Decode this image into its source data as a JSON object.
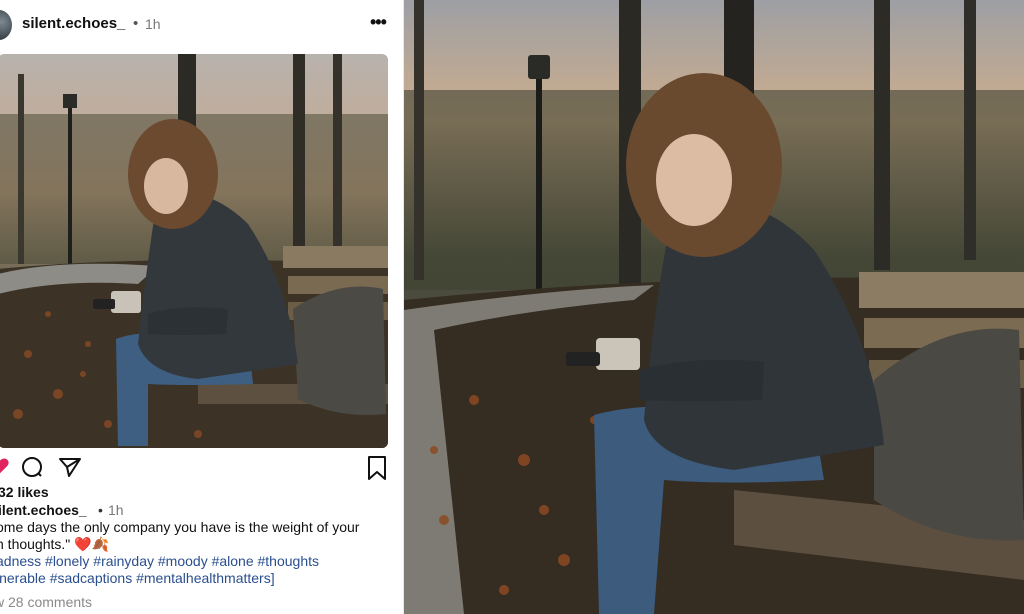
{
  "post": {
    "username": "silent.echoes_",
    "separator": "•",
    "time": "1h",
    "more_label": "•••",
    "likes": "32 likes",
    "caption_username": "ilent.echoes_",
    "caption_separator": "•",
    "caption_time": "1h",
    "caption_line1": "ome days the only company you have is the weight of your",
    "caption_line2": "n thoughts.\"",
    "emoji": "❤️🍂",
    "tags_line1": "adness #lonely #rainyday #moody #alone #thoughts",
    "tags_line2": "lnerable #sadcaptions #mentalhealthmatters]",
    "comments_link": "w 28 comments"
  },
  "colors": {
    "hashtag": "#2a4f8f",
    "like_heart": "#e0245e",
    "muted_text": "#8a8a8a"
  },
  "icons": [
    "heart-icon",
    "comment-icon",
    "share-icon",
    "bookmark-icon",
    "more-icon"
  ]
}
